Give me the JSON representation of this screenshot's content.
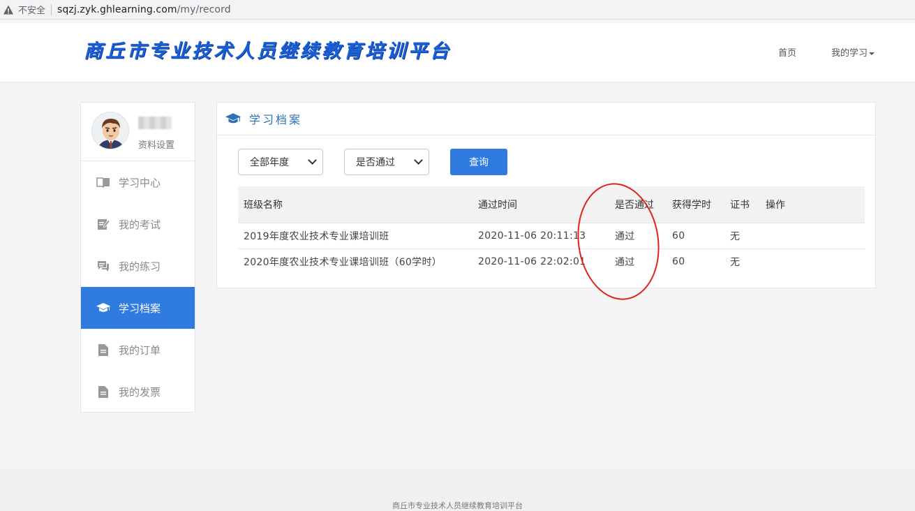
{
  "browser": {
    "insecure_label": "不安全",
    "url_host": "sqzj.zyk.ghlearning.com",
    "url_path": "/my/record"
  },
  "header": {
    "site_title": "商丘市专业技术人员继续教育培训平台",
    "nav": {
      "home": "首页",
      "my_study": "我的学习"
    }
  },
  "sidebar": {
    "profile_link": "资料设置",
    "items": [
      {
        "label": "学习中心",
        "icon": "book-icon"
      },
      {
        "label": "我的考试",
        "icon": "edit-icon"
      },
      {
        "label": "我的练习",
        "icon": "chat-icon"
      },
      {
        "label": "学习档案",
        "icon": "graduation-cap-icon",
        "active": true
      },
      {
        "label": "我的订单",
        "icon": "document-icon"
      },
      {
        "label": "我的发票",
        "icon": "document-icon"
      }
    ]
  },
  "main": {
    "title": "学习档案",
    "filters": {
      "year_selected": "全部年度",
      "pass_selected": "是否通过",
      "query_button": "查询"
    },
    "table": {
      "headers": [
        "班级名称",
        "通过时间",
        "是否通过",
        "获得学时",
        "证书",
        "操作"
      ],
      "rows": [
        [
          "2019年度农业技术专业课培训班",
          "2020-11-06 20:11:13",
          "通过",
          "60",
          "无",
          ""
        ],
        [
          "2020年度农业技术专业课培训班（60学时）",
          "2020-11-06 22:02:01",
          "通过",
          "60",
          "无",
          ""
        ]
      ]
    }
  },
  "footer": {
    "text": "商丘市专业技术人员继续教育培训平台"
  },
  "colors": {
    "accent": "#2f7be0",
    "title": "#1b5fd6",
    "annotation": "#e0201a"
  }
}
